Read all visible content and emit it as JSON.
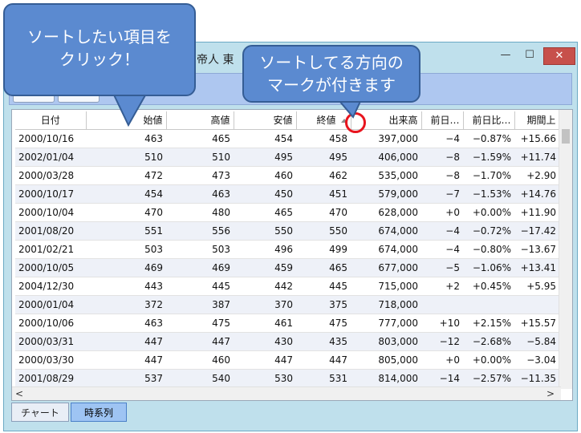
{
  "window": {
    "title": "）帝人 東",
    "buttons": {
      "minimize": "—",
      "maximize": "☐",
      "close": "✕"
    }
  },
  "grid": {
    "columns": [
      "日付",
      "始値",
      "高値",
      "安値",
      "終値",
      "出来高",
      "前日…",
      "前日比…",
      "期間上"
    ],
    "sort_column_index": 4,
    "sort_direction": "ascending",
    "rows": [
      [
        "2000/10/16",
        "463",
        "465",
        "454",
        "458",
        "397,000",
        "−4",
        "−0.87%",
        "+15.66"
      ],
      [
        "2002/01/04",
        "510",
        "510",
        "495",
        "495",
        "406,000",
        "−8",
        "−1.59%",
        "+11.74"
      ],
      [
        "2000/03/28",
        "472",
        "473",
        "460",
        "462",
        "535,000",
        "−8",
        "−1.70%",
        "+2.90"
      ],
      [
        "2000/10/17",
        "454",
        "463",
        "450",
        "451",
        "579,000",
        "−7",
        "−1.53%",
        "+14.76"
      ],
      [
        "2000/10/04",
        "470",
        "480",
        "465",
        "470",
        "628,000",
        "+0",
        "+0.00%",
        "+11.90"
      ],
      [
        "2001/08/20",
        "551",
        "556",
        "550",
        "550",
        "674,000",
        "−4",
        "−0.72%",
        "−17.42"
      ],
      [
        "2001/02/21",
        "503",
        "503",
        "496",
        "499",
        "674,000",
        "−4",
        "−0.80%",
        "−13.67"
      ],
      [
        "2000/10/05",
        "469",
        "469",
        "459",
        "465",
        "677,000",
        "−5",
        "−1.06%",
        "+13.41"
      ],
      [
        "2004/12/30",
        "443",
        "445",
        "442",
        "445",
        "715,000",
        "+2",
        "+0.45%",
        "+5.95"
      ],
      [
        "2000/01/04",
        "372",
        "387",
        "370",
        "375",
        "718,000",
        "",
        "",
        ""
      ],
      [
        "2000/10/06",
        "463",
        "475",
        "461",
        "475",
        "777,000",
        "+10",
        "+2.15%",
        "+15.57"
      ],
      [
        "2000/03/31",
        "447",
        "447",
        "430",
        "435",
        "803,000",
        "−12",
        "−2.68%",
        "−5.84"
      ],
      [
        "2000/03/30",
        "447",
        "460",
        "447",
        "447",
        "805,000",
        "+0",
        "+0.00%",
        "−3.04"
      ],
      [
        "2001/08/29",
        "537",
        "540",
        "530",
        "531",
        "814,000",
        "−14",
        "−2.57%",
        "−11.35"
      ]
    ]
  },
  "scrollbar": {
    "left_arrow": "<",
    "right_arrow": ">"
  },
  "tabs": [
    "チャート",
    "時系列"
  ],
  "active_tab": "時系列",
  "callouts": {
    "left": "ソートしたい項目を\nクリック！",
    "right": "ソートしてる方向の\nマークが付きます"
  },
  "colors": {
    "callout_fill": "#5b8ad0",
    "highlight_circle": "#e8141e",
    "active_tab": "#9ec4f3"
  }
}
